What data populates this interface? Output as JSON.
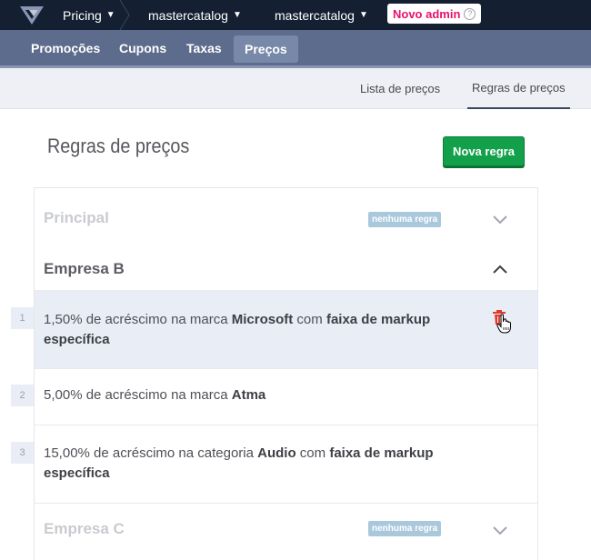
{
  "topbar": {
    "app": "Pricing",
    "account": "mastercatalog",
    "workspace": "mastercatalog",
    "badge": "Novo admin",
    "help": "?"
  },
  "tabs": [
    {
      "label": "Promoções"
    },
    {
      "label": "Cupons"
    },
    {
      "label": "Taxas"
    },
    {
      "label": "Preços",
      "active": true
    }
  ],
  "subtabs": [
    {
      "label": "Lista de preços"
    },
    {
      "label": "Regras de preços",
      "active": true
    }
  ],
  "page": {
    "title": "Regras de preços",
    "new_button": "Nova regra"
  },
  "groups": [
    {
      "name": "Principal",
      "tag": "nenhuma regra",
      "expanded": false
    },
    {
      "name": "Empresa B",
      "expanded": true
    },
    {
      "name": "Empresa C",
      "tag": "nenhuma regra",
      "expanded": false
    }
  ],
  "rules": [
    {
      "index": "1",
      "pre": "1,50% de acréscimo na marca ",
      "target": "Microsoft",
      "mid": " com ",
      "suffix": "faixa de markup específica"
    },
    {
      "index": "2",
      "pre": "5,00% de acréscimo na marca ",
      "target": "Atma",
      "mid": "",
      "suffix": ""
    },
    {
      "index": "3",
      "pre": "15,00% de acréscimo na categoria ",
      "target": "Audio",
      "mid": " com ",
      "suffix": "faixa de markup específica"
    }
  ],
  "colors": {
    "topbar": "#142032",
    "tabsbar": "#5d6c8c",
    "primary_button": "#13a04a",
    "badge_text": "#e8106e",
    "tag": "#a9c8dc",
    "delete_icon": "#e03a2f"
  }
}
